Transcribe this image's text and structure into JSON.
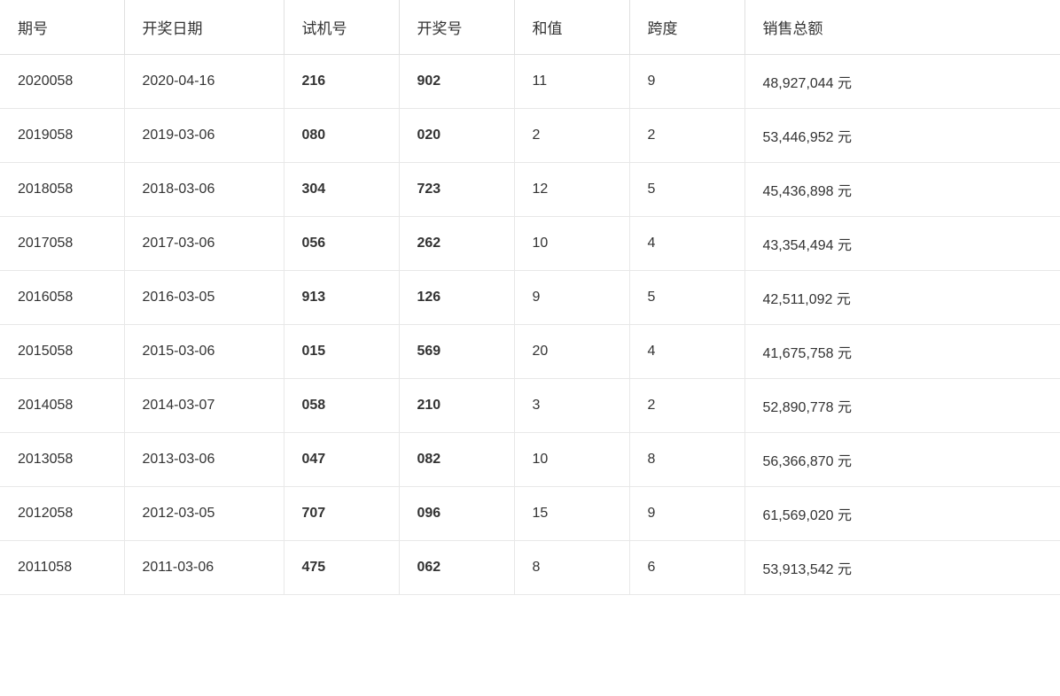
{
  "table": {
    "columns": [
      "期号",
      "开奖日期",
      "试机号",
      "开奖号",
      "和值",
      "跨度",
      "销售总额"
    ],
    "rows": [
      {
        "period": "2020058",
        "date": "2020-04-16",
        "trial": "216",
        "winning": "902",
        "sum": "11",
        "span": "9",
        "sales": "48,927,044 元"
      },
      {
        "period": "2019058",
        "date": "2019-03-06",
        "trial": "080",
        "winning": "020",
        "sum": "2",
        "span": "2",
        "sales": "53,446,952 元"
      },
      {
        "period": "2018058",
        "date": "2018-03-06",
        "trial": "304",
        "winning": "723",
        "sum": "12",
        "span": "5",
        "sales": "45,436,898 元"
      },
      {
        "period": "2017058",
        "date": "2017-03-06",
        "trial": "056",
        "winning": "262",
        "sum": "10",
        "span": "4",
        "sales": "43,354,494 元"
      },
      {
        "period": "2016058",
        "date": "2016-03-05",
        "trial": "913",
        "winning": "126",
        "sum": "9",
        "span": "5",
        "sales": "42,511,092 元"
      },
      {
        "period": "2015058",
        "date": "2015-03-06",
        "trial": "015",
        "winning": "569",
        "sum": "20",
        "span": "4",
        "sales": "41,675,758 元"
      },
      {
        "period": "2014058",
        "date": "2014-03-07",
        "trial": "058",
        "winning": "210",
        "sum": "3",
        "span": "2",
        "sales": "52,890,778 元"
      },
      {
        "period": "2013058",
        "date": "2013-03-06",
        "trial": "047",
        "winning": "082",
        "sum": "10",
        "span": "8",
        "sales": "56,366,870 元"
      },
      {
        "period": "2012058",
        "date": "2012-03-05",
        "trial": "707",
        "winning": "096",
        "sum": "15",
        "span": "9",
        "sales": "61,569,020 元"
      },
      {
        "period": "2011058",
        "date": "2011-03-06",
        "trial": "475",
        "winning": "062",
        "sum": "8",
        "span": "6",
        "sales": "53,913,542 元"
      }
    ]
  }
}
